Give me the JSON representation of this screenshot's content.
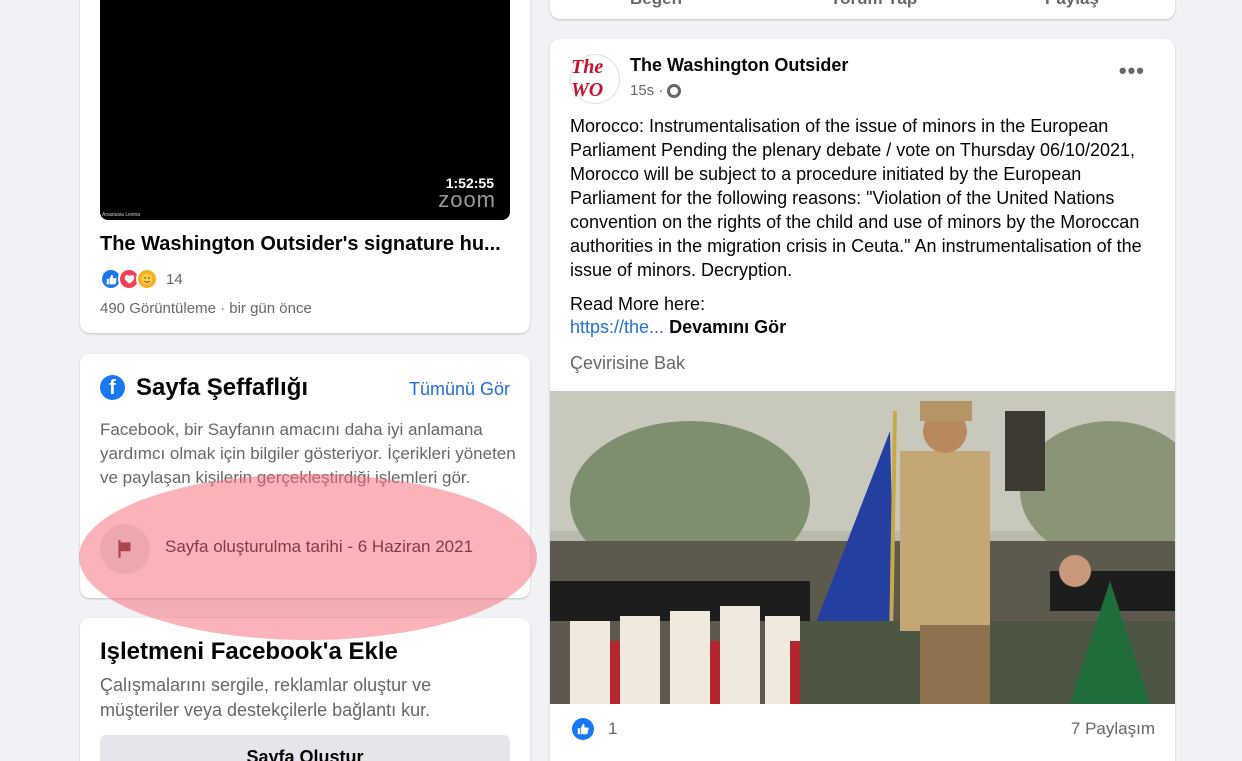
{
  "colors": {
    "accent": "#1877f2",
    "link": "#216fdb",
    "highlight": "#f86e78",
    "background": "#f0f2f5"
  },
  "video": {
    "duration": "1:52:55",
    "watermark": "zoom",
    "speaker": "Anastasia Levina",
    "title": "The Washington Outsider's signature hu...",
    "reaction_icons": [
      "like-icon",
      "love-icon",
      "care-icon"
    ],
    "reaction_count": "14",
    "views": "490 Görüntüleme · bir gün önce"
  },
  "transparency": {
    "title": "Sayfa Şeffaflığı",
    "see_all": "Tümünü Gör",
    "description": "Facebook, bir Sayfanın amacını daha iyi anlamana yardımcı olmak için bilgiler gösteriyor. İçerikleri yöneten ve paylaşan kişilerin gerçekleştirdiği işlemleri gör.",
    "created": "Sayfa oluşturulma tarihi - 6 Haziran 2021"
  },
  "business": {
    "title": "Işletmeni Facebook'a Ekle",
    "description": "Çalışmalarını sergile, reklamlar oluştur ve müşteriler veya destekçilerle bağlantı kur.",
    "button": "Sayfa Oluştur"
  },
  "prev_actions": {
    "like": "Beğen",
    "comment": "Yorum Yap",
    "share": "Paylaş"
  },
  "post": {
    "avatar_text": "The WO",
    "page_name": "The Washington Outsider",
    "time": "15s ·",
    "body": "Morocco: Instrumentalisation of the issue of minors in the European Parliament Pending the plenary debate / vote on Thursday 06/10/2021, Morocco will be subject to a procedure initiated by the European Parliament for the following reasons: \"Violation of the United Nations convention on the rights of the child and use of minors by the Moroccan authorities in the migration crisis in Ceuta.\" An instrumentalisation of the issue of minors. Decryption.",
    "read_more": "Read More here:",
    "link": "https://the...",
    "see_more": " Devamını Gör",
    "translate": "Çevirisine Bak",
    "like_count": "1",
    "shares": "7 Paylaşım"
  }
}
